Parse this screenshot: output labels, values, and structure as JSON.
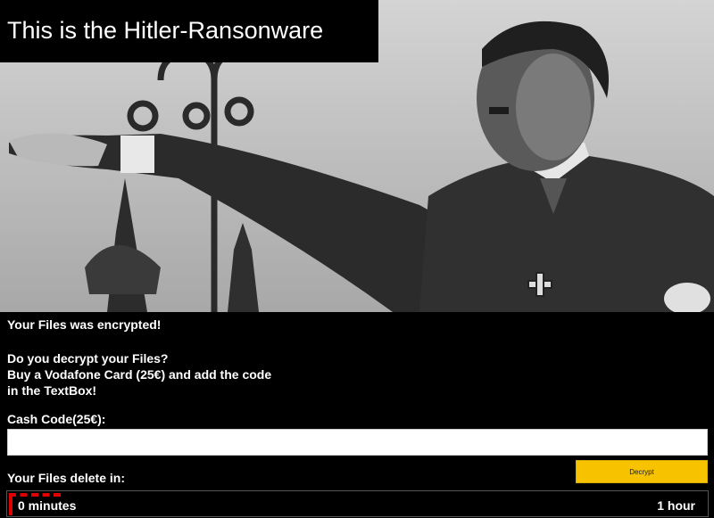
{
  "header": {
    "title": "This is the Hitler-Ransonware"
  },
  "message": {
    "encrypted": "Your Files was encrypted!",
    "question": "Do you decrypt your Files?",
    "instruction_line1": "Buy a Vodafone Card (25€) and add the code",
    "instruction_line2": "in the TextBox!"
  },
  "cash_code": {
    "label": "Cash Code(25€):",
    "value": ""
  },
  "decrypt_button": {
    "label": "Decrypt"
  },
  "timer": {
    "label": "Your Files delete in:",
    "current": "0 minutes",
    "max": "1 hour"
  },
  "colors": {
    "background": "#000000",
    "accent_button": "#f7c300",
    "timer_marker": "#e00000"
  }
}
